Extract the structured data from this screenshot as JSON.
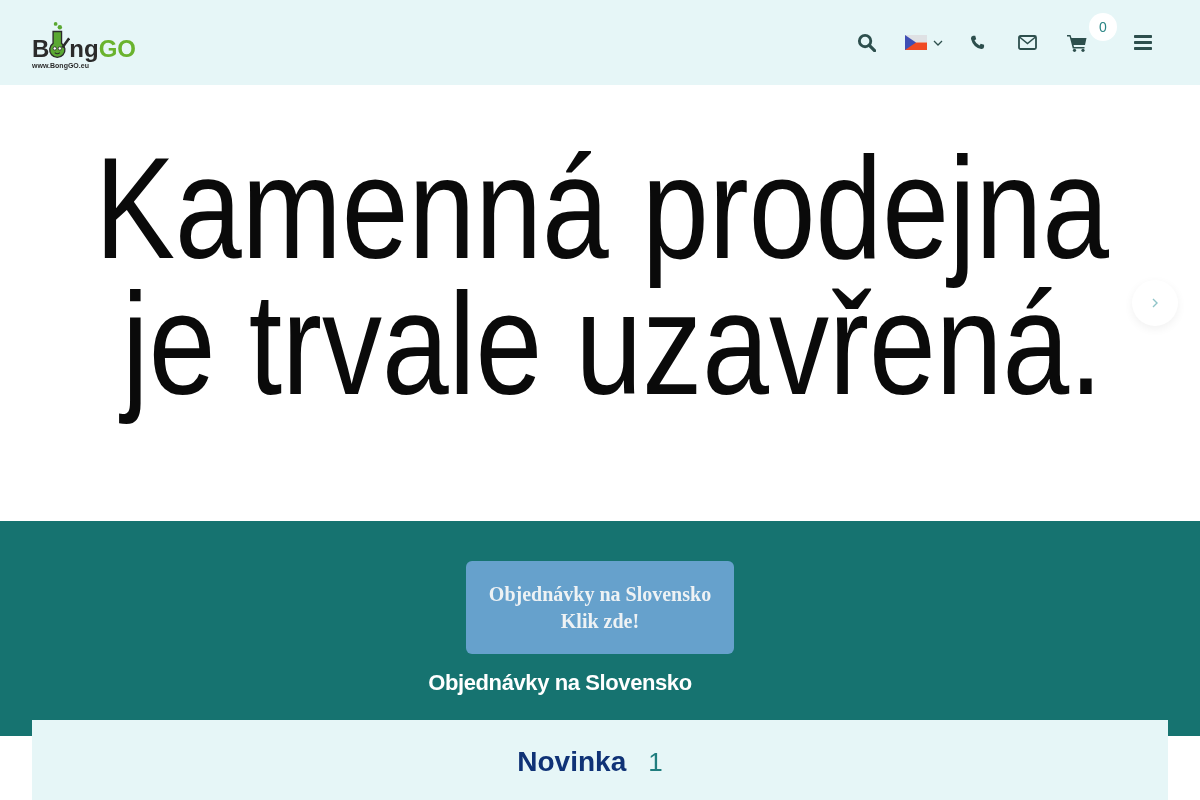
{
  "header": {
    "logo": {
      "lead": "B",
      "rest": "ng",
      "accent": "GO",
      "url": "www.BongGO.eu"
    },
    "cart": {
      "count": "0"
    }
  },
  "hero": {
    "lines": [
      "Kamenná prodejna",
      "je trvale uzavřená."
    ]
  },
  "promo": {
    "banner_lines": [
      "Objednávky na Slovensko",
      "Klik zde!"
    ],
    "caption": "Objednávky na Slovensko"
  },
  "section": {
    "title": "Novinka",
    "count": "1"
  }
}
